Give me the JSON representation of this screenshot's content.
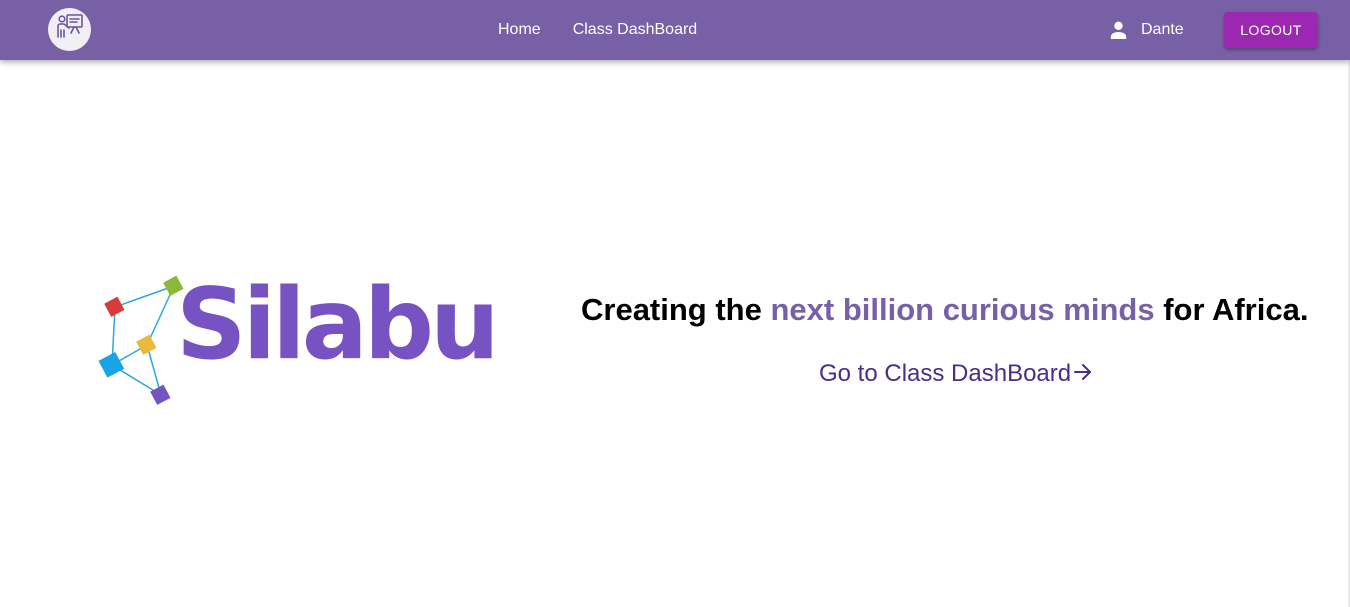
{
  "navbar": {
    "logo_icon": "teacher-board-icon",
    "links": [
      {
        "label": "Home"
      },
      {
        "label": "Class DashBoard"
      }
    ],
    "user": {
      "icon": "person-icon",
      "name": "Dante"
    },
    "logout_label": "LOGOUT"
  },
  "hero": {
    "brand_name": "Silabu",
    "tagline": {
      "before": "Creating the ",
      "highlight": "next billion curious minds",
      "after": " for Africa."
    },
    "cta_label": "Go to Class DashBoard",
    "cta_icon": "arrow-right-icon"
  },
  "colors": {
    "navbar": "#7760a6",
    "logout_button": "#9c27b0",
    "brand_purple": "#7652c2",
    "highlight": "#7760a6",
    "cta_text": "#4a2d88",
    "node_red": "#d93a3a",
    "node_green": "#8ab93a",
    "node_yellow": "#e8b93a",
    "node_blue": "#18a4e6",
    "node_purple": "#7652c2",
    "node_lines": "#29a7e1"
  }
}
